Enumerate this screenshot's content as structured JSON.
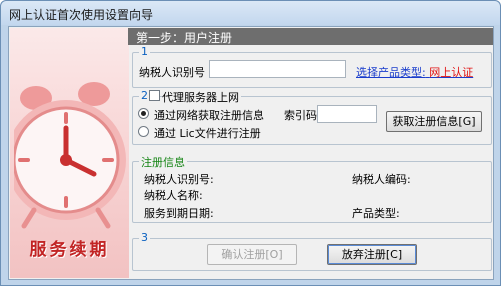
{
  "window": {
    "title": "网上认证首次使用设置向导"
  },
  "art": {
    "caption": "服务续期"
  },
  "step": {
    "header": "第一步：用户注册"
  },
  "group1": {
    "number": "1",
    "taxpayer_id_label": "纳税人识别号",
    "taxpayer_id_value": "",
    "product_link_prefix": "选择产品类型:",
    "product_link_value": "网上认证"
  },
  "group2": {
    "number": "2",
    "proxy_label": "代理服务器上网",
    "radio_network_label": "通过网络获取注册信息",
    "index_code_label": "索引码",
    "index_code_value": "",
    "radio_lic_label": "通过 Lic文件进行注册",
    "get_info_button": "获取注册信息[G]"
  },
  "reg_info": {
    "title": "注册信息",
    "taxpayer_id_label": "纳税人识别号:",
    "taxpayer_code_label": "纳税人编码:",
    "taxpayer_name_label": "纳税人名称:",
    "service_expiry_label": "服务到期日期:",
    "product_type_label": "产品类型:"
  },
  "group3": {
    "number": "3",
    "confirm_button": "确认注册[O]",
    "abandon_button": "放弃注册[C]"
  },
  "colors": {
    "accent_red": "#c22424",
    "link_blue": "#1a3dcc",
    "group_label_green": "#158515"
  }
}
